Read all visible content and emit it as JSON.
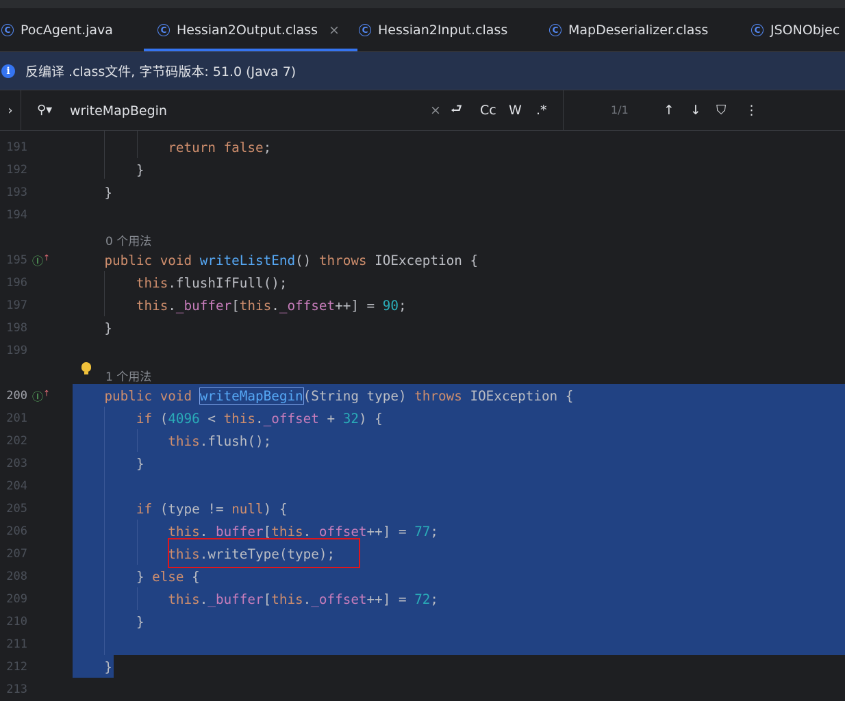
{
  "tabs": [
    {
      "label": "PocAgent.java",
      "icon": "class-c-icon"
    },
    {
      "label": "Hessian2Output.class",
      "icon": "class-c-icon",
      "active": true
    },
    {
      "label": "Hessian2Input.class",
      "icon": "class-c-icon"
    },
    {
      "label": "MapDeserializer.class",
      "icon": "class-c-icon"
    },
    {
      "label": "JSONObjec",
      "icon": "class-c-icon"
    }
  ],
  "tab_close": "×",
  "info": {
    "icon": "i",
    "text": "反编译 .class文件, 字节码版本: 51.0 (Java 7)"
  },
  "search": {
    "query": "writeMapBegin",
    "clear": "×",
    "newline": "⮐",
    "case": "Cc",
    "word": "W",
    "regex": ".*",
    "count": "1/1",
    "prev": "↑",
    "next": "↓",
    "filter": "⛉",
    "more": "⋮"
  },
  "hints": {
    "h195": "0 个用法",
    "h200": "1 个用法"
  },
  "gutter": [
    "191",
    "192",
    "193",
    "194",
    "195",
    "196",
    "197",
    "198",
    "199",
    "200",
    "201",
    "202",
    "203",
    "204",
    "205",
    "206",
    "207",
    "208",
    "209",
    "210",
    "211",
    "212",
    "213"
  ],
  "colors": {
    "selection": "#214283",
    "keyword": "#cf8e6d",
    "method": "#56a8f5",
    "field": "#c77dbb",
    "number": "#2aacb8",
    "highlight_box": "#e0161b"
  }
}
